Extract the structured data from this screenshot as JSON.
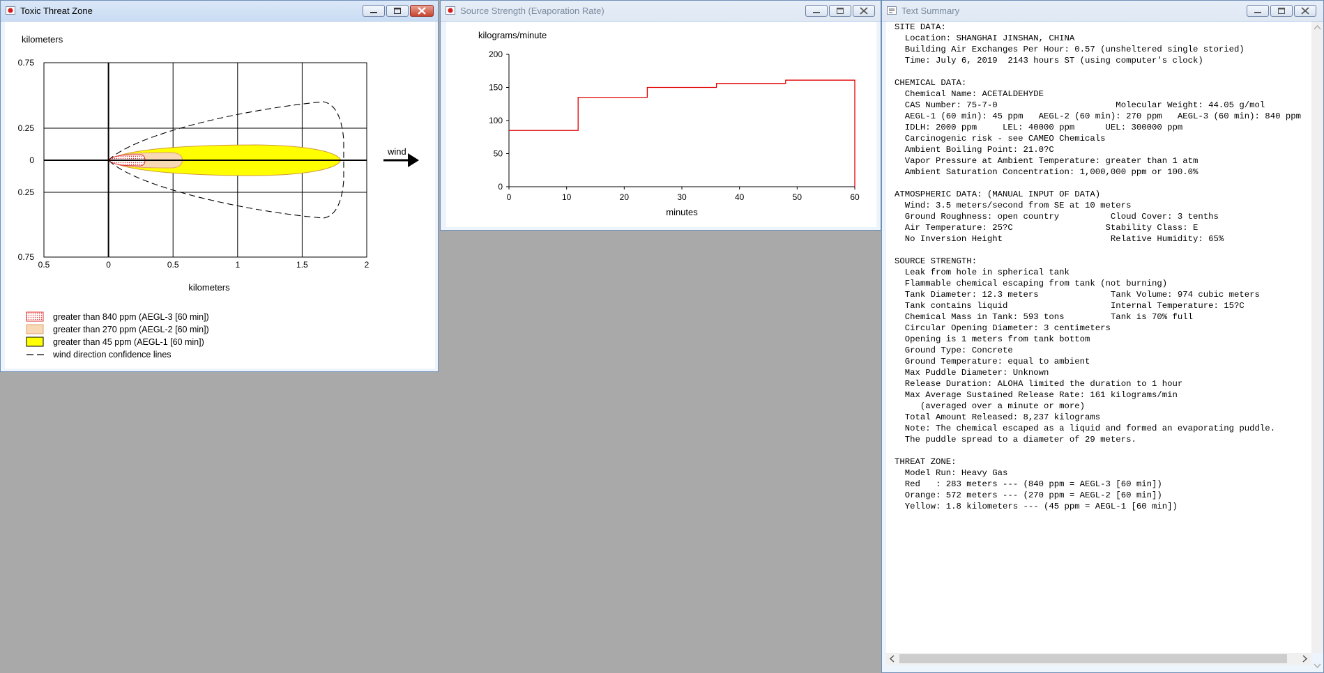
{
  "windows": {
    "threat": {
      "title": "Toxic Threat Zone"
    },
    "source": {
      "title": "Source Strength (Evaporation Rate)"
    },
    "summary": {
      "title": "Text Summary"
    }
  },
  "threat_plot": {
    "y_unit": "kilometers",
    "x_unit": "kilometers",
    "y_ticks": [
      "0.75",
      "0.25",
      "0",
      "0.25",
      "0.75"
    ],
    "x_ticks": [
      "0.5",
      "0",
      "0.5",
      "1",
      "1.5",
      "2"
    ],
    "wind_label": "wind",
    "legend": [
      {
        "label": "greater than 840 ppm (AEGL-3 [60 min])",
        "swatch": "red-dotted"
      },
      {
        "label": "greater than 270 ppm (AEGL-2 [60 min])",
        "swatch": "orange"
      },
      {
        "label": "greater than 45 ppm (AEGL-1 [60 min])",
        "swatch": "yellow"
      },
      {
        "label": "wind direction confidence lines",
        "swatch": "dash"
      }
    ],
    "colors": {
      "red": "#e03030",
      "orange": "#f7d9b5",
      "yellow": "#ffff00",
      "plume_outline": "#d09a3a"
    },
    "zones_km": {
      "red": 0.283,
      "orange": 0.572,
      "yellow": 1.8
    }
  },
  "chart_data": {
    "type": "line",
    "title": "",
    "xlabel": "minutes",
    "ylabel": "kilograms/minute",
    "xlim": [
      0,
      60
    ],
    "ylim": [
      0,
      200
    ],
    "x_ticks": [
      0,
      10,
      20,
      30,
      40,
      50,
      60
    ],
    "y_ticks": [
      0,
      50,
      100,
      150,
      200
    ],
    "series": [
      {
        "style": "step",
        "color": "#e00000",
        "x": [
          0,
          12,
          12,
          24,
          24,
          36,
          36,
          48,
          48,
          60,
          60
        ],
        "y": [
          85,
          85,
          135,
          135,
          150,
          150,
          156,
          156,
          161,
          161,
          0
        ]
      }
    ]
  },
  "summary": {
    "lines": [
      "SITE DATA:",
      "  Location: SHANGHAI JINSHAN, CHINA",
      "  Building Air Exchanges Per Hour: 0.57 (unsheltered single storied)",
      "  Time: July 6, 2019  2143 hours ST (using computer's clock)",
      "",
      "CHEMICAL DATA:",
      "  Chemical Name: ACETALDEHYDE",
      "  CAS Number: 75-7-0                       Molecular Weight: 44.05 g/mol",
      "  AEGL-1 (60 min): 45 ppm   AEGL-2 (60 min): 270 ppm   AEGL-3 (60 min): 840 ppm",
      "  IDLH: 2000 ppm     LEL: 40000 ppm      UEL: 300000 ppm",
      "  Carcinogenic risk - see CAMEO Chemicals",
      "  Ambient Boiling Point: 21.0?C",
      "  Vapor Pressure at Ambient Temperature: greater than 1 atm",
      "  Ambient Saturation Concentration: 1,000,000 ppm or 100.0%",
      "",
      "ATMOSPHERIC DATA: (MANUAL INPUT OF DATA)",
      "  Wind: 3.5 meters/second from SE at 10 meters",
      "  Ground Roughness: open country          Cloud Cover: 3 tenths",
      "  Air Temperature: 25?C                  Stability Class: E",
      "  No Inversion Height                     Relative Humidity: 65%",
      "",
      "SOURCE STRENGTH:",
      "  Leak from hole in spherical tank",
      "  Flammable chemical escaping from tank (not burning)",
      "  Tank Diameter: 12.3 meters              Tank Volume: 974 cubic meters",
      "  Tank contains liquid                    Internal Temperature: 15?C",
      "  Chemical Mass in Tank: 593 tons         Tank is 70% full",
      "  Circular Opening Diameter: 3 centimeters",
      "  Opening is 1 meters from tank bottom",
      "  Ground Type: Concrete",
      "  Ground Temperature: equal to ambient",
      "  Max Puddle Diameter: Unknown",
      "  Release Duration: ALOHA limited the duration to 1 hour",
      "  Max Average Sustained Release Rate: 161 kilograms/min",
      "     (averaged over a minute or more)",
      "  Total Amount Released: 8,237 kilograms",
      "  Note: The chemical escaped as a liquid and formed an evaporating puddle.",
      "  The puddle spread to a diameter of 29 meters.",
      "",
      "THREAT ZONE:",
      "  Model Run: Heavy Gas",
      "  Red   : 283 meters --- (840 ppm = AEGL-3 [60 min])",
      "  Orange: 572 meters --- (270 ppm = AEGL-2 [60 min])",
      "  Yellow: 1.8 kilometers --- (45 ppm = AEGL-1 [60 min])"
    ]
  }
}
